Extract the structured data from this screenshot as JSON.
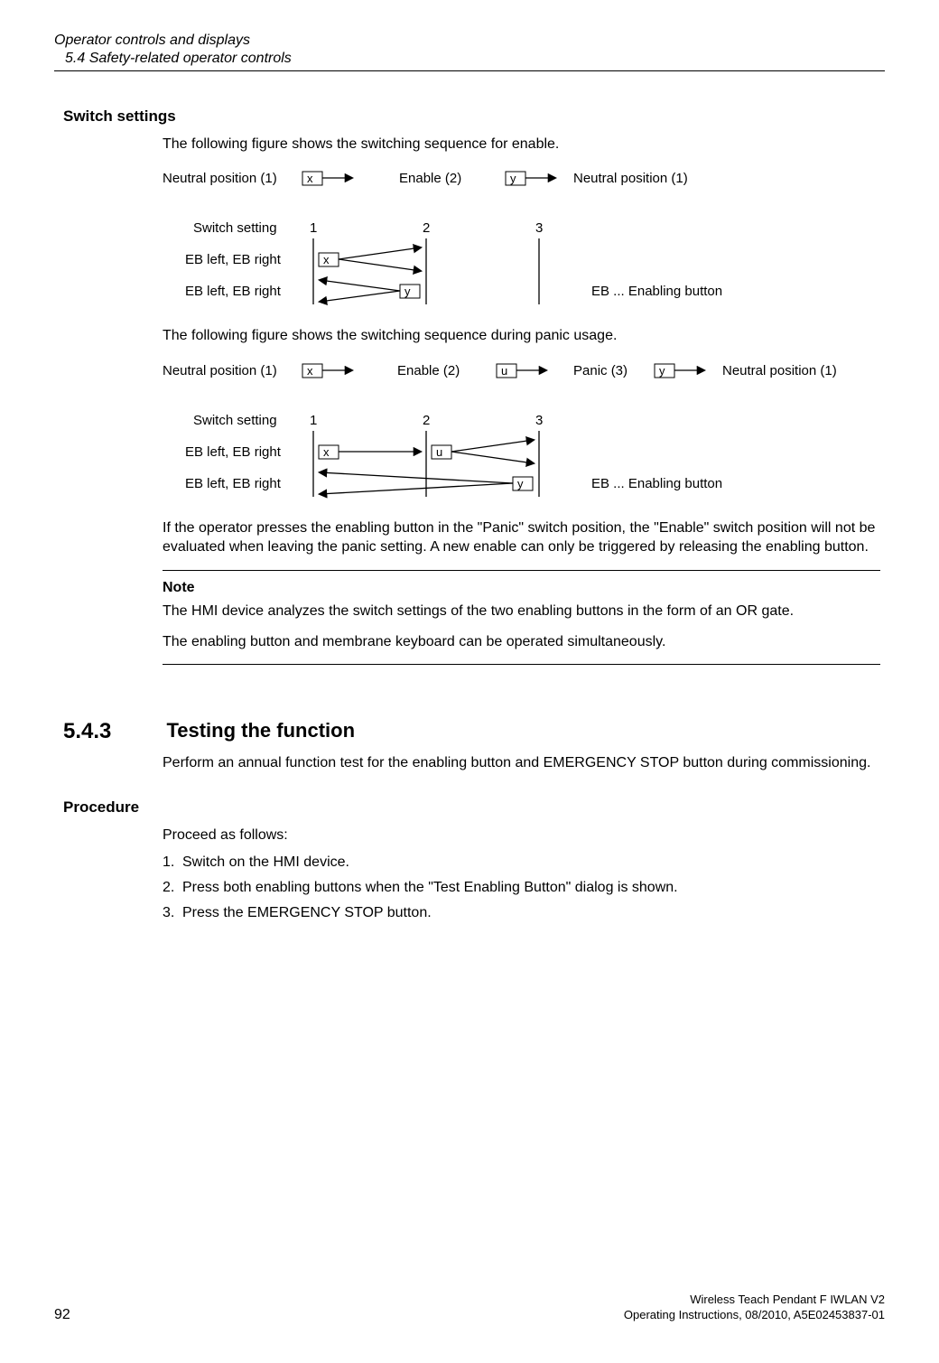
{
  "header": {
    "title": "Operator controls and displays",
    "subtitle": "5.4 Safety-related operator controls"
  },
  "switch_settings": {
    "heading": "Switch settings",
    "intro1": "The following figure shows the switching sequence for enable.",
    "intro2": "The following figure shows the switching sequence during panic usage.",
    "after_figs": "If the operator presses the enabling button in the \"Panic\" switch position, the \"Enable\" switch position will not be evaluated when leaving the panic setting. A new enable can only be triggered by releasing the enabling button."
  },
  "diagram1": {
    "top": {
      "left": "Neutral position (1)",
      "middle": "Enable (2)",
      "right": "Neutral position (1)",
      "arrow1": "x",
      "arrow2": "y"
    },
    "rows": {
      "label_setting": "Switch setting",
      "col1": "1",
      "col2": "2",
      "col3": "3",
      "row1": "EB left, EB right",
      "row2": "EB left, EB right",
      "x": "x",
      "y": "y"
    },
    "caption": "EB ... Enabling button"
  },
  "diagram2": {
    "top": {
      "c1": "Neutral position (1)",
      "c2": "Enable (2)",
      "c3": "Panic (3)",
      "c4": "Neutral position (1)",
      "a1": "x",
      "a2": "u",
      "a3": "y"
    },
    "rows": {
      "label_setting": "Switch setting",
      "col1": "1",
      "col2": "2",
      "col3": "3",
      "row1": "EB left, EB right",
      "row2": "EB left, EB right",
      "x": "x",
      "u": "u",
      "y": "y"
    },
    "caption": "EB ... Enabling button"
  },
  "note": {
    "label": "Note",
    "p1": "The HMI device analyzes the switch settings of the two enabling buttons in the form of an OR gate.",
    "p2": "The enabling button and membrane keyboard can be operated simultaneously."
  },
  "section_543": {
    "num": "5.4.3",
    "title": "Testing the function",
    "intro": "Perform an annual function test for the enabling button and EMERGENCY STOP button during commissioning."
  },
  "procedure": {
    "heading": "Procedure",
    "intro": "Proceed as follows:",
    "steps": [
      {
        "n": "1.",
        "t": "Switch on the HMI device."
      },
      {
        "n": "2.",
        "t": "Press both enabling buttons when the \"Test Enabling Button\" dialog is shown."
      },
      {
        "n": "3.",
        "t": "Press the EMERGENCY STOP button."
      }
    ]
  },
  "footer": {
    "page": "92",
    "line1": "Wireless Teach Pendant F IWLAN V2",
    "line2": "Operating Instructions, 08/2010, A5E02453837-01"
  }
}
